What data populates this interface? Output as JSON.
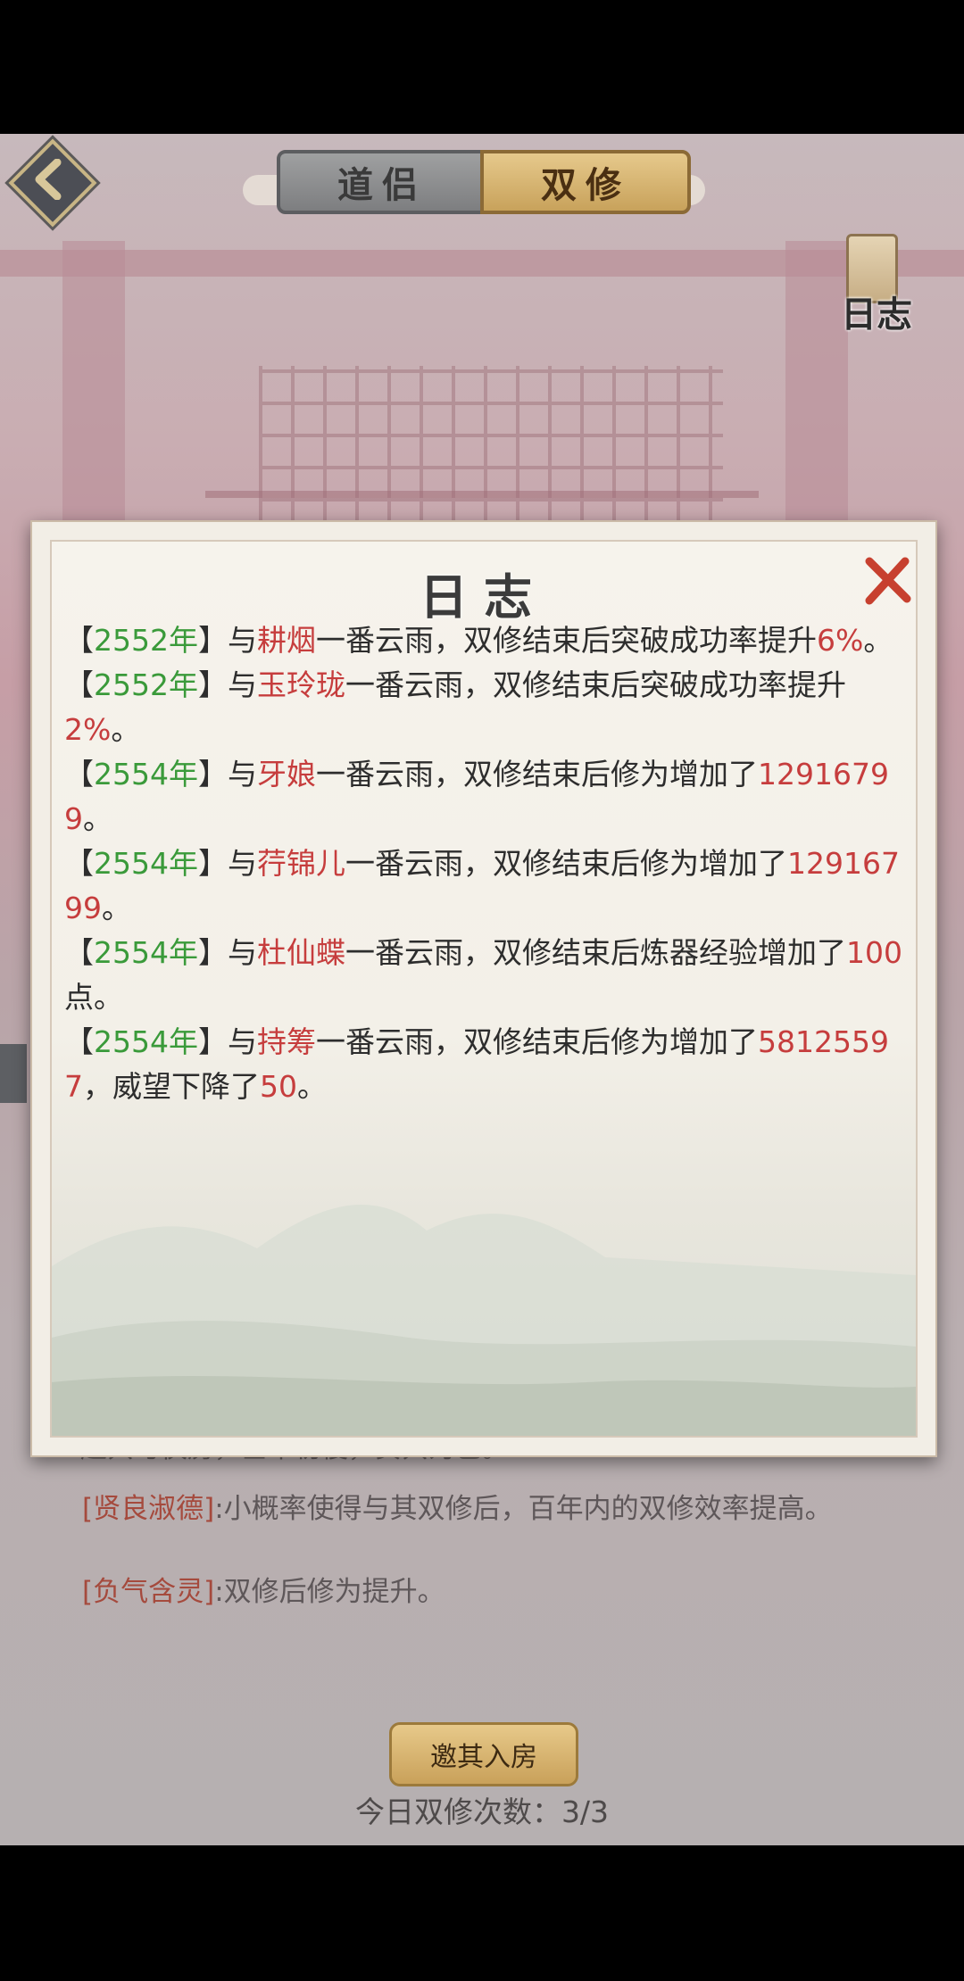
{
  "tabs": {
    "left": "道侣",
    "right": "双修"
  },
  "side_button": {
    "label": "日志"
  },
  "dialog": {
    "title": "日志",
    "entries": [
      {
        "lb": "【",
        "year": "2552年",
        "rb": "】",
        "p1": "与",
        "name": "耕烟",
        "p2": "一番云雨，双修结束后突破成功率提升",
        "value": "6%",
        "p3": "。"
      },
      {
        "lb": "【",
        "year": "2552年",
        "rb": "】",
        "p1": "与",
        "name": "玉玲珑",
        "p2": "一番云雨，双修结束后突破成功率提升",
        "value": "2%",
        "p3": "。"
      },
      {
        "lb": "【",
        "year": "2554年",
        "rb": "】",
        "p1": "与",
        "name": "牙娘",
        "p2": "一番云雨，双修结束后修为增加了",
        "value": "12916799",
        "p3": "。"
      },
      {
        "lb": "【",
        "year": "2554年",
        "rb": "】",
        "p1": "与",
        "name": "荇锦儿",
        "p2": "一番云雨，双修结束后修为增加了",
        "value": "12916799",
        "p3": "。"
      },
      {
        "lb": "【",
        "year": "2554年",
        "rb": "】",
        "p1": "与",
        "name": "杜仙蝶",
        "p2": "一番云雨，双修结束后炼器经验增加了",
        "value": "100",
        "p3": "点。"
      },
      {
        "lb": "【",
        "year": "2554年",
        "rb": "】",
        "p1": "与",
        "name": "持筹",
        "p2": "一番云雨，双修结束后修为增加了",
        "value": "58125597",
        "p3": "，威望下降了",
        "value2": "50",
        "p4": "。"
      }
    ]
  },
  "page": {
    "partial_line": "起共与侠房，基本初慢，负共为已。",
    "traits": [
      {
        "name": "[贤良淑德]",
        "desc": ":小概率使得与其双修后，百年内的双修效率提高。"
      },
      {
        "name": "[负气含灵]",
        "desc": ":双修后修为提升。"
      }
    ],
    "invite_button": "邀其入房",
    "daily_count_label": "今日双修次数：",
    "daily_count_value": "3/3"
  },
  "colors": {
    "year": "#3a9a3a",
    "highlight": "#c63d3d",
    "trait_name": "#a54a3d",
    "tab_active": "#d9b978"
  }
}
